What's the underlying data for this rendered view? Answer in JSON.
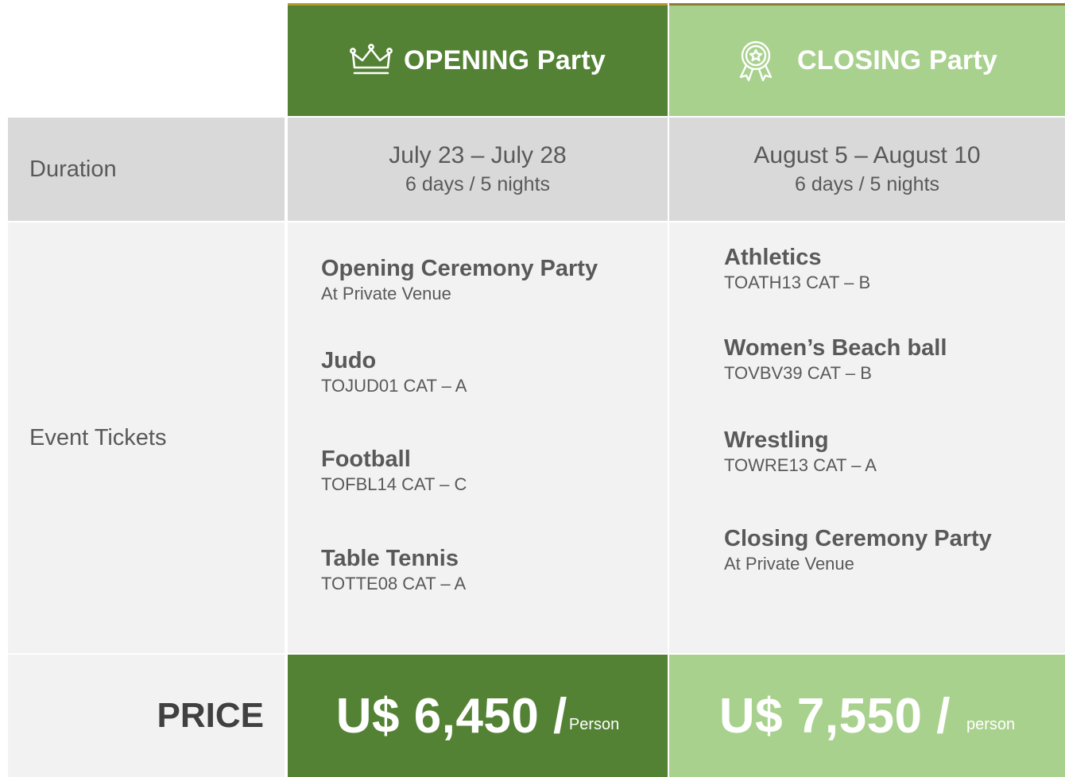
{
  "header": {
    "opening_title": "OPENING Party",
    "closing_title": "CLOSING Party",
    "opening_icon": "crown-icon",
    "closing_icon": "award-ribbon-icon"
  },
  "duration": {
    "label": "Duration",
    "opening": {
      "dates": "July 23 – July 28",
      "length": "6 days / 5 nights"
    },
    "closing": {
      "dates": "August 5 – August 10",
      "length": "6 days / 5 nights"
    }
  },
  "tickets": {
    "label": "Event Tickets",
    "opening": [
      {
        "name": "Opening Ceremony Party",
        "detail": "At Private Venue"
      },
      {
        "name": "Judo",
        "detail": "TOJUD01 CAT – A"
      },
      {
        "name": "Football",
        "detail": "TOFBL14 CAT – C"
      },
      {
        "name": "Table Tennis",
        "detail": "TOTTE08 CAT – A"
      }
    ],
    "closing": [
      {
        "name": "Athletics",
        "detail": "TOATH13 CAT – B"
      },
      {
        "name": "Women’s Beach ball",
        "detail": "TOVBV39 CAT – B"
      },
      {
        "name": "Wrestling",
        "detail": "TOWRE13 CAT – A"
      },
      {
        "name": "Closing Ceremony Party",
        "detail": "At Private Venue"
      }
    ]
  },
  "price": {
    "label": "PRICE",
    "opening": {
      "value": "U$ 6,450 /",
      "unit": "Person"
    },
    "closing": {
      "value": "U$ 7,550 /",
      "unit": "person"
    }
  },
  "colors": {
    "opening_green": "#548235",
    "closing_green": "#a9d18e",
    "row_gray": "#d9d9d9",
    "row_light": "#f2f2f2",
    "text": "#595959"
  }
}
